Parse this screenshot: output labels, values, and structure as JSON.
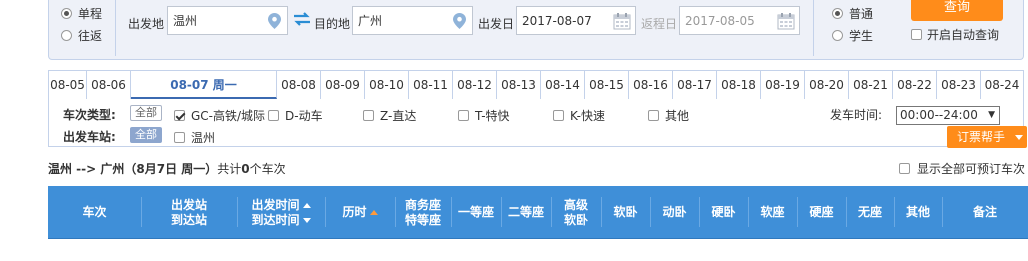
{
  "search": {
    "trip_types": [
      {
        "label": "单程",
        "checked": true
      },
      {
        "label": "往返",
        "checked": false
      }
    ],
    "from_label": "出发地",
    "from_value": "温州",
    "to_label": "目的地",
    "to_value": "广州",
    "depart_label": "出发日",
    "depart_value": "2017-08-07",
    "return_label": "返程日",
    "return_value": "2017-08-05",
    "passenger_types": [
      {
        "label": "普通",
        "checked": true
      },
      {
        "label": "学生",
        "checked": false
      }
    ],
    "query_label": "查询",
    "auto_query_label": "开启自动查询"
  },
  "date_tabs": [
    {
      "label": "08-05",
      "active": false
    },
    {
      "label": "08-06",
      "active": false
    },
    {
      "label": "08-07 周一",
      "active": true
    },
    {
      "label": "08-08",
      "active": false
    },
    {
      "label": "08-09",
      "active": false
    },
    {
      "label": "08-10",
      "active": false
    },
    {
      "label": "08-11",
      "active": false
    },
    {
      "label": "08-12",
      "active": false
    },
    {
      "label": "08-13",
      "active": false
    },
    {
      "label": "08-14",
      "active": false
    },
    {
      "label": "08-15",
      "active": false
    },
    {
      "label": "08-16",
      "active": false
    },
    {
      "label": "08-17",
      "active": false
    },
    {
      "label": "08-18",
      "active": false
    },
    {
      "label": "08-19",
      "active": false
    },
    {
      "label": "08-20",
      "active": false
    },
    {
      "label": "08-21",
      "active": false
    },
    {
      "label": "08-22",
      "active": false
    },
    {
      "label": "08-23",
      "active": false
    },
    {
      "label": "08-24",
      "active": false
    }
  ],
  "filters": {
    "train_type_label": "车次类型:",
    "all_label": "全部",
    "train_types": [
      {
        "label": "GC-高铁/城际",
        "checked": true
      },
      {
        "label": "D-动车",
        "checked": false
      },
      {
        "label": "Z-直达",
        "checked": false
      },
      {
        "label": "T-特快",
        "checked": false
      },
      {
        "label": "K-快速",
        "checked": false
      },
      {
        "label": "其他",
        "checked": false
      }
    ],
    "station_label": "出发车站:",
    "stations": [
      {
        "label": "温州",
        "checked": false
      }
    ],
    "depart_time_label": "发车时间:",
    "depart_time_value": "00:00--24:00",
    "help_label": "订票帮手"
  },
  "summary": {
    "route": "温州 --> 广州（8月7日  周一）",
    "prefix": "共计",
    "count": "0",
    "suffix": "个车次",
    "show_all_label": "显示全部可预订车次"
  },
  "table_header": {
    "train_no": "车次",
    "depart_station": "出发站",
    "arrive_station": "到达站",
    "depart_time": "出发时间",
    "arrive_time": "到达时间",
    "duration": "历时",
    "business_1": "商务座",
    "business_2": "特等座",
    "first_class": "一等座",
    "second_class": "二等座",
    "premium_sleeper_1": "高级",
    "premium_sleeper_2": "软卧",
    "soft_sleeper": "软卧",
    "emu_sleeper": "动卧",
    "hard_sleeper": "硬卧",
    "soft_seat": "软座",
    "hard_seat": "硬座",
    "no_seat": "无座",
    "other": "其他",
    "remark": "备注"
  }
}
